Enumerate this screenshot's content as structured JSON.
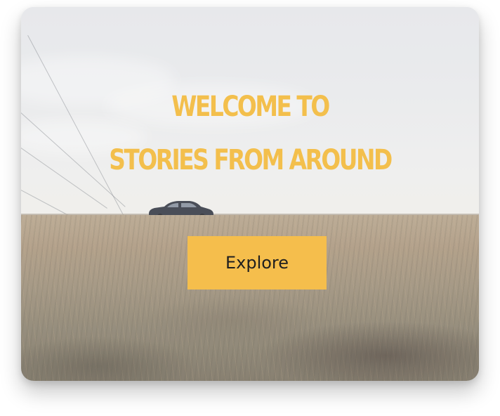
{
  "hero": {
    "title_line1": "WELCOME TO",
    "title_line2": "STORIES FROM AROUND",
    "button_label": "Explore"
  },
  "colors": {
    "accent": "#F5BE4C",
    "title": "#F3BF4C",
    "button_text": "#1F1F1F"
  },
  "background_image": {
    "subject": "grass-field-with-car-on-horizon"
  }
}
